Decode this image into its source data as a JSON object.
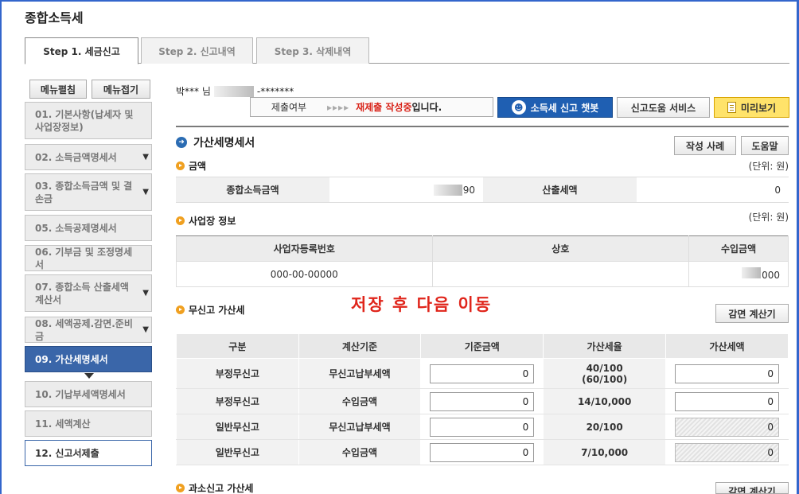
{
  "app_title": "종합소득세",
  "tabs": [
    {
      "label": "Step 1. 세금신고",
      "active": true
    },
    {
      "label": "Step 2. 신고내역",
      "active": false
    },
    {
      "label": "Step 3. 삭제내역",
      "active": false
    }
  ],
  "menu_buttons": {
    "expand": "메뉴펼침",
    "collapse": "메뉴접기"
  },
  "sidebar": {
    "items": [
      {
        "label": "01. 기본사항(납세자 및 사업장정보)",
        "chevron": false
      },
      {
        "label": "02. 소득금액명세서",
        "chevron": true
      },
      {
        "label": "03. 종합소득금액 및 결손금",
        "chevron": true
      },
      {
        "label": "05. 소득공제명세서",
        "chevron": false
      },
      {
        "label": "06. 기부금 및 조정명세서",
        "chevron": false
      },
      {
        "label": "07. 종합소득 산출세액계산서",
        "chevron": true
      },
      {
        "label": "08. 세액공제.감면.준비금",
        "chevron": true
      },
      {
        "label": "09. 가산세명세서",
        "chevron": false,
        "state": "active"
      },
      {
        "label": "10. 기납부세액명세서",
        "chevron": false
      },
      {
        "label": "11. 세액계산",
        "chevron": false
      },
      {
        "label": "12. 신고서제출",
        "chevron": false,
        "state": "current"
      }
    ]
  },
  "user": {
    "name": "박*** 님",
    "id_tail": "-*******"
  },
  "status": {
    "label": "제출여부",
    "arrows": "▸▸▸▸",
    "red_text": "재제출 작성중",
    "suffix": "입니다."
  },
  "buttons": {
    "chatbot": "소득세 신고 챗봇",
    "help_service": "신고도움 서비스",
    "preview": "미리보기",
    "example": "작성 사례",
    "help": "도움말",
    "calc1": "감면 계산기",
    "calc2": "감면 계산기"
  },
  "section_title": "가산세명세서",
  "amount_section": {
    "title": "금액",
    "unit": "(단위: 원)",
    "total_income_label": "종합소득금액",
    "total_income_value": "90",
    "calc_tax_label": "산출세액",
    "calc_tax_value": "0"
  },
  "business_section": {
    "title": "사업장 정보",
    "unit": "(단위: 원)",
    "headers": [
      "사업자등록번호",
      "상호",
      "수입금액"
    ],
    "rows": [
      {
        "reg_no": "000-00-00000",
        "name": "",
        "income": "000"
      }
    ]
  },
  "overlay_message": "저장 후 다음 이동",
  "no_report_section": {
    "title": "무신고 가산세",
    "headers": [
      "구분",
      "계산기준",
      "기준금액",
      "가산세율",
      "가산세액"
    ],
    "rows": [
      {
        "type": "부정무신고",
        "basis": "무신고납부세액",
        "base_amount": "0",
        "rate": "40/100",
        "rate2": "(60/100)",
        "penalty": "0",
        "penalty_disabled": false
      },
      {
        "type": "부정무신고",
        "basis": "수입금액",
        "base_amount": "0",
        "rate": "14/10,000",
        "rate2": "",
        "penalty": "0",
        "penalty_disabled": false
      },
      {
        "type": "일반무신고",
        "basis": "무신고납부세액",
        "base_amount": "0",
        "rate": "20/100",
        "rate2": "",
        "penalty": "0",
        "penalty_disabled": true
      },
      {
        "type": "일반무신고",
        "basis": "수입금액",
        "base_amount": "0",
        "rate": "7/10,000",
        "rate2": "",
        "penalty": "0",
        "penalty_disabled": true
      }
    ]
  },
  "under_report_section": {
    "title": "과소신고 가산세"
  },
  "colors": {
    "accent_blue": "#3a66a9",
    "chatbot_blue": "#1f5fb2",
    "preview_yellow": "#ffe36a",
    "alert_red": "#e0251b",
    "bullet_orange": "#f0a020"
  }
}
